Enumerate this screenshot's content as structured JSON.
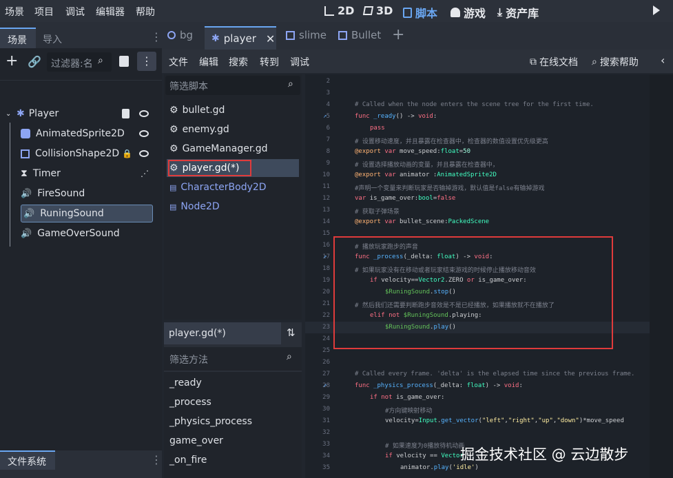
{
  "menubar": {
    "menus": [
      "场景",
      "项目",
      "调试",
      "编辑器",
      "帮助"
    ],
    "main_tabs": [
      "2D",
      "3D",
      "脚本",
      "游戏",
      "资产库"
    ]
  },
  "scene_panel": {
    "tabs": [
      "场景",
      "导入"
    ],
    "filter_placeholder": "过滤器:名",
    "nodes": [
      {
        "label": "Player"
      },
      {
        "label": "AnimatedSprite2D"
      },
      {
        "label": "CollisionShape2D"
      },
      {
        "label": "Timer"
      },
      {
        "label": "FireSound"
      },
      {
        "label": "RuningSound"
      },
      {
        "label": "GameOverSound"
      }
    ],
    "filesystem_tab": "文件系统"
  },
  "script_tabs": [
    "bg",
    "player",
    "slime",
    "Bullet"
  ],
  "script_menu": [
    "文件",
    "编辑",
    "搜索",
    "转到",
    "调试"
  ],
  "script_menu_right": [
    "在线文档",
    "搜索帮助"
  ],
  "script_list": {
    "filter_placeholder": "筛选脚本",
    "items": [
      "bullet.gd",
      "enemy.gd",
      "GameManager.gd",
      "player.gd(*)",
      "CharacterBody2D",
      "Node2D"
    ]
  },
  "method_panel": {
    "title": "player.gd(*)",
    "filter_placeholder": "筛选方法",
    "methods": [
      "_ready",
      "_process",
      "_physics_process",
      "game_over",
      "_on_fire"
    ]
  },
  "code_lines": [
    "2",
    "3",
    "4",
    "5",
    "6",
    "7",
    "8",
    "9",
    "10",
    "11",
    "12",
    "13",
    "14",
    "15",
    "16",
    "17",
    "18",
    "19",
    "20",
    "21",
    "22",
    "23",
    "24",
    "25",
    "26",
    "27",
    "28",
    "29",
    "30",
    "31",
    "32",
    "33",
    "34",
    "35"
  ],
  "code_text": {
    "l4": "# Called when the node enters the scene tree for the first time.",
    "l5a": "func ",
    "l5b": "_ready",
    "l5c": "() -> ",
    "l5d": "void",
    "l5e": ":",
    "l6": "pass",
    "l7": "# 设置移动速度，并且暴露在检查器中，检查器的数值设置优先级更高",
    "l8a": "@export",
    "l8b": " var ",
    "l8c": "move_speed",
    "l8d": ":",
    "l8e": "float",
    "l8f": "=",
    "l8g": "50",
    "l9": "# 设置选择播放动画的变量，并且暴露在检查器中，",
    "l10a": "@export",
    "l10b": " var ",
    "l10c": "animator ",
    "l10d": ":",
    "l10e": "AnimatedSprite2D",
    "l11": "#声明一个变量来判断玩家是否输掉游戏，默认值是false有输掉游戏",
    "l12a": "var ",
    "l12b": "is_game_over",
    "l12c": ":",
    "l12d": "bool",
    "l12e": "=",
    "l12f": "false",
    "l13": "# 获取子弹场景",
    "l14a": "@export",
    "l14b": " var ",
    "l14c": "bullet_scene",
    "l14d": ":",
    "l14e": "PackedScene",
    "l16": "# 播放玩家跑步的声音",
    "l17a": "func ",
    "l17b": "_process",
    "l17c": "(_delta: ",
    "l17d": "float",
    "l17e": ") -> ",
    "l17f": "void",
    "l17g": ":",
    "l18": "# 如果玩家没有在移动或者玩家结束游戏的时候停止播放移动音效",
    "l19a": "if ",
    "l19b": "velocity",
    "l19c": "==",
    "l19d": "Vector2",
    "l19e": ".ZERO ",
    "l19f": "or ",
    "l19g": "is_game_over",
    "l19h": ":",
    "l20a": "$RuningSound",
    "l20b": ".",
    "l20c": "stop",
    "l20d": "()",
    "l21": "# 然后我们还需要判断跑步音效是不是已经播放，如果播放就不在播放了",
    "l22a": "elif ",
    "l22b": "not ",
    "l22c": "$RuningSound",
    "l22d": ".playing:",
    "l23a": "$RuningSound",
    "l23b": ".",
    "l23c": "play",
    "l23d": "()",
    "l27": "# Called every frame. 'delta' is the elapsed time since the previous frame.",
    "l28a": "func ",
    "l28b": "_physics_process",
    "l28c": "(_delta: ",
    "l28d": "float",
    "l28e": ") -> ",
    "l28f": "void",
    "l28g": ":",
    "l29a": "if ",
    "l29b": "not ",
    "l29c": "is_game_over",
    "l29d": ":",
    "l30": "#方向键映射移动",
    "l31a": "velocity",
    "l31b": "=",
    "l31c": "Input",
    "l31d": ".",
    "l31e": "get_vector",
    "l31f": "(",
    "l31g": "\"left\"",
    "l31h": ",",
    "l31i": "\"right\"",
    "l31j": ",",
    "l31k": "\"up\"",
    "l31l": ",",
    "l31m": "\"down\"",
    "l31n": ")*",
    "l31o": "move_speed",
    "l33": "# 如果速度为0播放待机动画",
    "l34a": "if ",
    "l34b": "velocity",
    "l34c": " == ",
    "l34d": "Vector",
    "l35a": "animator",
    "l35b": ".",
    "l35c": "play",
    "l35d": "(",
    "l35e": "'idle'",
    "l35f": ")"
  },
  "watermark": "掘金技术社区 @ 云边散步",
  "colors": {
    "accent": "#6aa7f2",
    "highlight_box": "#e03b3b"
  }
}
